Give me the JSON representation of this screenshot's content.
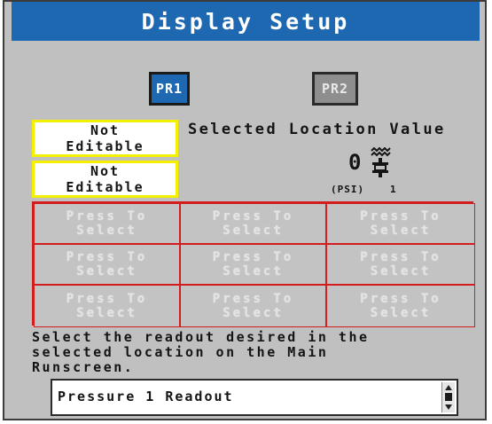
{
  "title": "Display Setup",
  "colors": {
    "title_bar": "#1d68b1",
    "screen_bg": "#c0c0c0",
    "pr1_active": "#1d68b1",
    "pr2_inactive": "#8e8e8e",
    "highlight_border": "#f4f000",
    "grid_border": "#d31c1c"
  },
  "sensors": {
    "pr1_label": "PR1",
    "pr2_label": "PR2",
    "active": "PR1"
  },
  "left_boxes": [
    {
      "line1": "Not",
      "line2": "Editable"
    },
    {
      "line1": "Not",
      "line2": "Editable"
    }
  ],
  "selected_location": {
    "label": "Selected Location Value",
    "value": "0",
    "unit": "(PSI)",
    "sensor_number": "1",
    "icon": "pressure-sensor-icon"
  },
  "select_grid": [
    [
      "Press To\nSelect",
      "Press To\nSelect",
      "Press To\nSelect"
    ],
    [
      "Press To\nSelect",
      "Press To\nSelect",
      "Press To\nSelect"
    ],
    [
      "Press To\nSelect",
      "Press To\nSelect",
      "Press To\nSelect"
    ]
  ],
  "instructions": "Select the readout desired in the\nselected location on the Main\nRunscreen.",
  "readout_selector": {
    "value": "Pressure 1 Readout",
    "icon": "scroll-arrows-icon"
  }
}
